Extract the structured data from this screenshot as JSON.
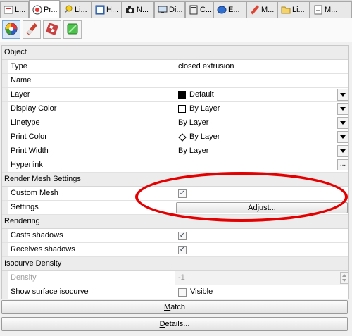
{
  "tabs": [
    {
      "label": "L...",
      "icon": "layers-icon"
    },
    {
      "label": "Pr...",
      "icon": "properties-icon",
      "active": true
    },
    {
      "label": "Li...",
      "icon": "light-icon"
    },
    {
      "label": "H...",
      "icon": "help-icon"
    },
    {
      "label": "N...",
      "icon": "camera-icon"
    },
    {
      "label": "Di...",
      "icon": "display-icon"
    },
    {
      "label": "C...",
      "icon": "calculator-icon"
    },
    {
      "label": "E...",
      "icon": "environment-icon"
    },
    {
      "label": "M...",
      "icon": "materials-icon"
    },
    {
      "label": "Li...",
      "icon": "folder-icon"
    },
    {
      "label": "M...",
      "icon": "document-icon"
    }
  ],
  "toolbar": {
    "buttons": [
      "object-properties-icon",
      "material-icon",
      "texture-mapping-icon",
      "decal-icon"
    ]
  },
  "object": {
    "section": "Object",
    "type_label": "Type",
    "type_value": "closed extrusion",
    "name_label": "Name",
    "name_value": "",
    "layer_label": "Layer",
    "layer_value": "Default",
    "layer_color": "#000000",
    "display_color_label": "Display Color",
    "display_color_value": "By Layer",
    "linetype_label": "Linetype",
    "linetype_value": "By Layer",
    "print_color_label": "Print Color",
    "print_color_value": "By Layer",
    "print_width_label": "Print Width",
    "print_width_value": "By Layer",
    "hyperlink_label": "Hyperlink",
    "hyperlink_value": "",
    "hyperlink_button": "..."
  },
  "render_mesh": {
    "section": "Render Mesh Settings",
    "custom_mesh_label": "Custom Mesh",
    "custom_mesh_checked": true,
    "settings_label": "Settings",
    "adjust_button": "Adjust..."
  },
  "rendering": {
    "section": "Rendering",
    "casts_label": "Casts shadows",
    "casts_checked": true,
    "receives_label": "Receives shadows",
    "receives_checked": true
  },
  "isocurve": {
    "section": "Isocurve Density",
    "density_label": "Density",
    "density_value": "-1",
    "show_label": "Show surface isocurve",
    "show_checked": false,
    "show_value": "Visible"
  },
  "buttons": {
    "match_prefix": "",
    "match_underline": "M",
    "match_rest": "atch",
    "details_prefix": "",
    "details_underline": "D",
    "details_rest": "etails..."
  },
  "colors": {
    "annotation": "#e40000",
    "selection": "#dbe8f7"
  }
}
